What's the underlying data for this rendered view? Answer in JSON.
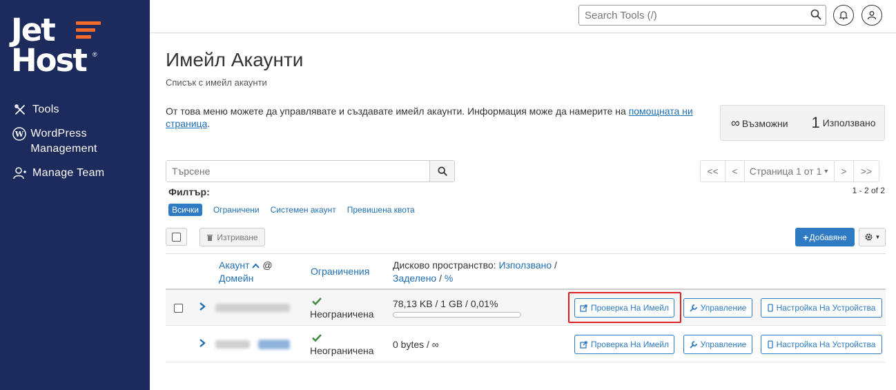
{
  "brand": {
    "line1": "Jet",
    "line2": "Host",
    "reg": "®",
    "accent": "#f26b2a",
    "sidebar_bg": "#1c2a5c"
  },
  "sidebar": {
    "items": [
      {
        "label": "Tools",
        "icon": "tools-icon"
      },
      {
        "label": "WordPress Management",
        "icon": "wordpress-icon"
      },
      {
        "label": "Manage Team",
        "icon": "team-icon"
      }
    ]
  },
  "topbar": {
    "search_placeholder": "Search Tools (/)"
  },
  "page": {
    "title": "Имейл Акаунти",
    "subtitle": "Списък с имейл акаунти",
    "desc": "От това меню можете да управлявате и създавате имейл акаунти. Информация може да намерите на ",
    "desc_link": "помощната ни страница",
    "desc_end": "."
  },
  "stats": {
    "possible_symbol": "∞",
    "possible_label": "Възможни",
    "used_value": "1",
    "used_label": "Използвано"
  },
  "table_search": {
    "placeholder": "Търсене"
  },
  "pager": {
    "first": "<<",
    "prev": "<",
    "page": "Страница 1 от 1",
    "next": ">",
    "last": ">>",
    "count": "1 - 2 of 2"
  },
  "filters": {
    "label": "Филтър:",
    "items": [
      "Всички",
      "Ограничени",
      "Системен акаунт",
      "Превишена квота"
    ]
  },
  "toolbar": {
    "delete": "Изтриване",
    "add": "Добавяне"
  },
  "columns": {
    "account": "Акаунт",
    "at": "@",
    "domain": "Домейн",
    "restrictions": "Ограничения",
    "disk_prefix": "Дисково пространство: ",
    "disk_used": "Използвано",
    "disk_sep1": " /",
    "disk_alloc": "Заделено",
    "disk_sep2": " / ",
    "disk_pct": "%"
  },
  "rows": [
    {
      "restriction": "Неограничена",
      "disk": "78,13 KB / 1 GB / 0,01%",
      "usage_fraction": 0.0001
    },
    {
      "restriction": "Неограничена",
      "disk": "0 bytes / ∞"
    }
  ],
  "actions": {
    "check": "Проверка На Имейл",
    "manage": "Управление",
    "devices": "Настройка На Устройства"
  }
}
